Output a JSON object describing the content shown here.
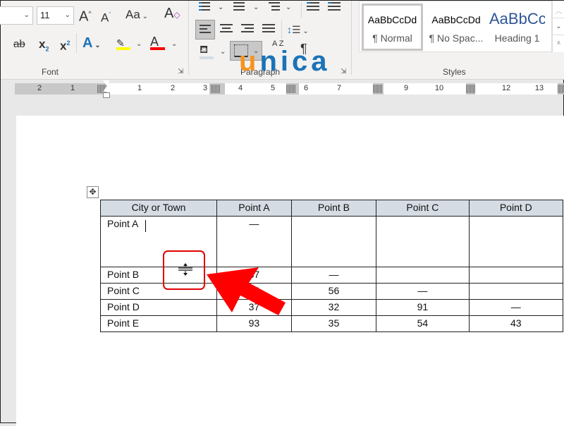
{
  "font_group": {
    "label": "Font",
    "font_size": "11",
    "grow_icon": "grow-font-icon",
    "shrink_icon": "shrink-font-icon",
    "change_case": "Aa",
    "strikethrough": "ab",
    "subscript": "x",
    "subscript_mark": "2",
    "superscript": "x",
    "superscript_mark": "2",
    "highlight_color": "#ffff00",
    "font_color": "#ff0000"
  },
  "paragraph_group": {
    "label": "Paragraph",
    "pilcrow": "¶",
    "sort": "A Z"
  },
  "styles_group": {
    "label": "Styles",
    "items": [
      {
        "sample": "AaBbCcDd",
        "name": "¶ Normal",
        "selected": true
      },
      {
        "sample": "AaBbCcDd",
        "name": "¶ No Spac..."
      },
      {
        "sample": "AaBbCc",
        "name": "Heading 1",
        "color": "#2f5597"
      }
    ]
  },
  "watermark": {
    "text": "unica",
    "u_color": "#f7931e",
    "rest_color": "#1a73b8"
  },
  "ruler": {
    "labels": [
      "2",
      "1",
      "1",
      "2",
      "3",
      "4",
      "5",
      "6",
      "7",
      "9",
      "10",
      "12",
      "13"
    ]
  },
  "table": {
    "headers": [
      "City or Town",
      "Point A",
      "Point B",
      "Point C",
      "Point D"
    ],
    "rows": [
      [
        "Point A",
        "—",
        "",
        "",
        ""
      ],
      [
        "Point B",
        "87",
        "—",
        "",
        ""
      ],
      [
        "Point C",
        "64",
        "56",
        "—",
        ""
      ],
      [
        "Point D",
        "37",
        "32",
        "91",
        "—"
      ],
      [
        "Point E",
        "93",
        "35",
        "54",
        "43"
      ]
    ]
  },
  "annotation": {
    "highlight_color": "#e00000",
    "cursor_icon": "row-resize-cursor-icon",
    "arrow_icon": "red-arrow-icon"
  }
}
